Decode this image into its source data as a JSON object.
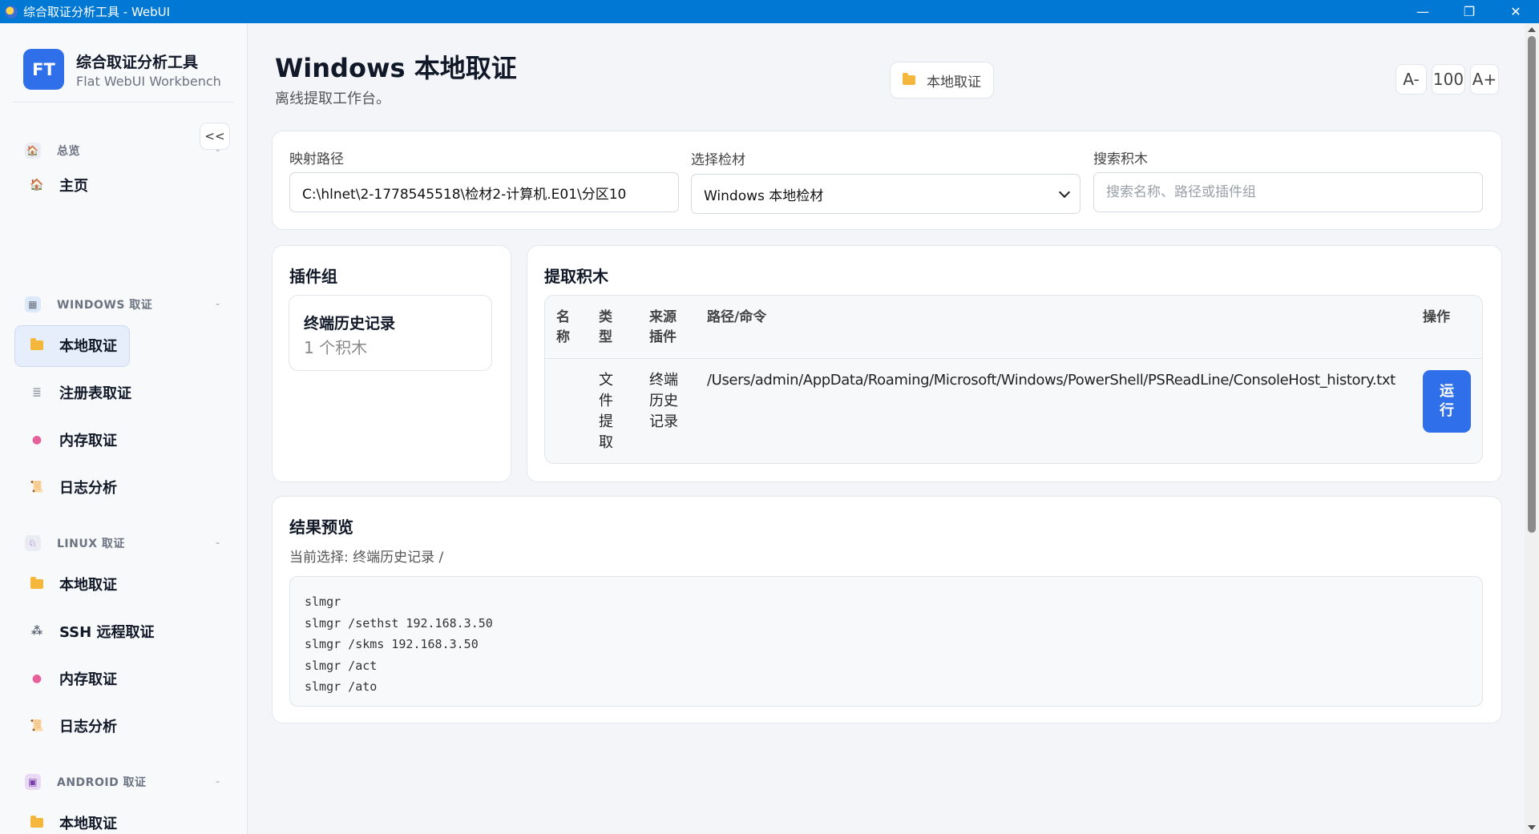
{
  "window": {
    "title": "综合取证分析工具 - WebUI",
    "minimize": "—",
    "maximize": "❐",
    "close": "✕"
  },
  "brand": {
    "logo": "FT",
    "title": "综合取证分析工具",
    "subtitle": "Flat WebUI Workbench",
    "collapse": "<<"
  },
  "sidebar": {
    "sections": [
      {
        "label": "总览",
        "icon": "home-icon",
        "collapse": "-"
      },
      {
        "label": "WINDOWS 取证",
        "icon": "windows-icon",
        "collapse": "-"
      },
      {
        "label": "LINUX 取证",
        "icon": "linux-icon",
        "collapse": "-"
      },
      {
        "label": "ANDROID 取证",
        "icon": "android-icon",
        "collapse": "-"
      }
    ],
    "items": [
      {
        "label": "主页",
        "icon": "home-icon"
      },
      {
        "label": "本地取证",
        "icon": "folder-icon"
      },
      {
        "label": "注册表取证",
        "icon": "registry-icon"
      },
      {
        "label": "内存取证",
        "icon": "memory-icon"
      },
      {
        "label": "日志分析",
        "icon": "log-icon"
      },
      {
        "label": "本地取证",
        "icon": "folder-icon"
      },
      {
        "label": "SSH 远程取证",
        "icon": "network-icon"
      },
      {
        "label": "内存取证",
        "icon": "memory-icon"
      },
      {
        "label": "日志分析",
        "icon": "log-icon"
      },
      {
        "label": "本地取证",
        "icon": "folder-icon"
      }
    ]
  },
  "header": {
    "title": "Windows 本地取证",
    "subtitle": "离线提取工作台。",
    "crumb": "本地取证",
    "zoom_out": "A-",
    "zoom_level": "100",
    "zoom_in": "A+"
  },
  "filters": {
    "path_label": "映射路径",
    "path_value": "C:\\hlnet\\2-1778545518\\检材2-计算机.E01\\分区10",
    "material_label": "选择检材",
    "material_value": "Windows 本地检材",
    "search_label": "搜索积木",
    "search_placeholder": "搜索名称、路径或插件组"
  },
  "plugin_groups": {
    "title": "插件组",
    "items": [
      {
        "name": "终端历史记录",
        "count": "1 个积木"
      }
    ]
  },
  "blocks": {
    "title": "提取积木",
    "headers": {
      "name": "名\n称",
      "type": "类\n型",
      "source": "来源\n插件",
      "path": "路径/命令",
      "action": "操作"
    },
    "rows": [
      {
        "name": "",
        "type": "文\n件\n提\n取",
        "source": "终端\n历史\n记录",
        "path": "/Users/admin/AppData/Roaming/Microsoft/Windows/PowerShell/PSReadLine/ConsoleHost_history.txt",
        "action": "运\n行"
      }
    ]
  },
  "results": {
    "title": "结果预览",
    "selection": "当前选择: 终端历史记录 /",
    "lines": [
      "slmgr",
      "slmgr /sethst 192.168.3.50",
      "slmgr /skms 192.168.3.50",
      "slmgr /act",
      "slmgr /ato"
    ]
  },
  "colors": {
    "titlebar": "#0078d4",
    "accent": "#2f6fea",
    "active_bg": "#e6eefc"
  }
}
